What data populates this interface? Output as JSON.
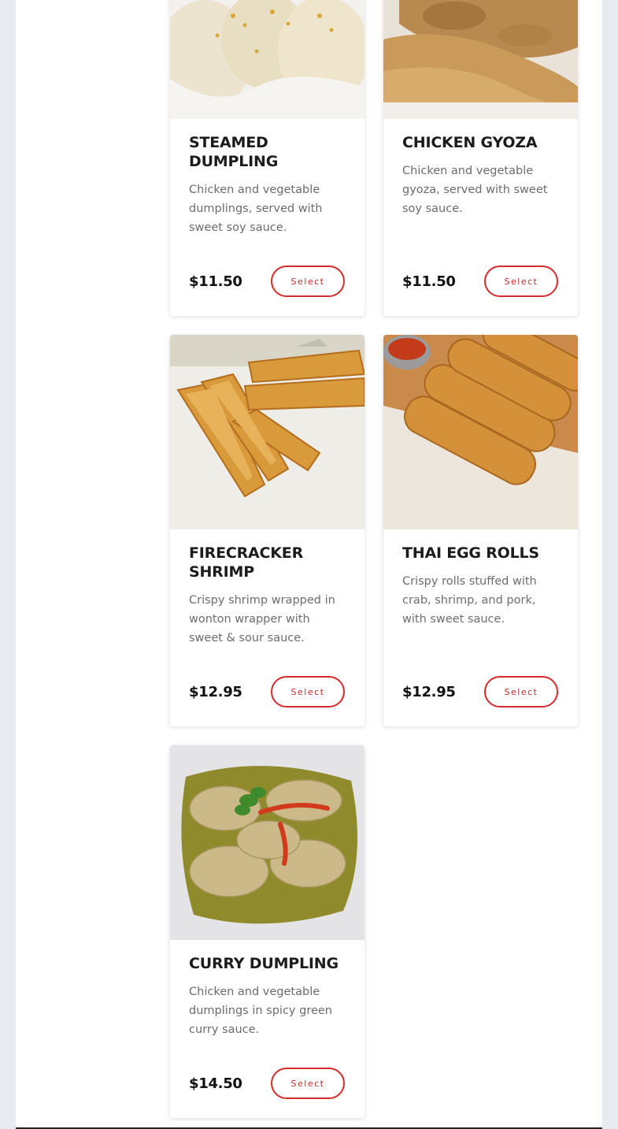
{
  "menu": {
    "items": [
      {
        "title": "Steamed Dumpling",
        "description": "Chicken and vegetable dumplings, served with sweet soy sauce.",
        "price": "$11.50",
        "button_label": "Select",
        "image_icon": "steamed-dumpling-photo"
      },
      {
        "title": "Chicken Gyoza",
        "description": "Chicken and vegetable gyoza, served with sweet soy sauce.",
        "price": "$11.50",
        "button_label": "Select",
        "image_icon": "chicken-gyoza-photo"
      },
      {
        "title": "Firecracker Shrimp",
        "description": "Crispy shrimp wrapped in wonton wrapper with sweet & sour sauce.",
        "price": "$12.95",
        "button_label": "Select",
        "image_icon": "firecracker-shrimp-photo"
      },
      {
        "title": "Thai Egg Rolls",
        "description": "Crispy rolls stuffed with crab, shrimp, and pork, with sweet sauce.",
        "price": "$12.95",
        "button_label": "Select",
        "image_icon": "thai-egg-rolls-photo"
      },
      {
        "title": "Curry Dumpling",
        "description": "Chicken and vegetable dumplings in spicy green curry sauce.",
        "price": "$14.50",
        "button_label": "Select",
        "image_icon": "curry-dumpling-photo"
      }
    ]
  },
  "colors": {
    "accent": "#d72b2b",
    "page_background": "#e7ebef",
    "card_background": "#ffffff"
  }
}
